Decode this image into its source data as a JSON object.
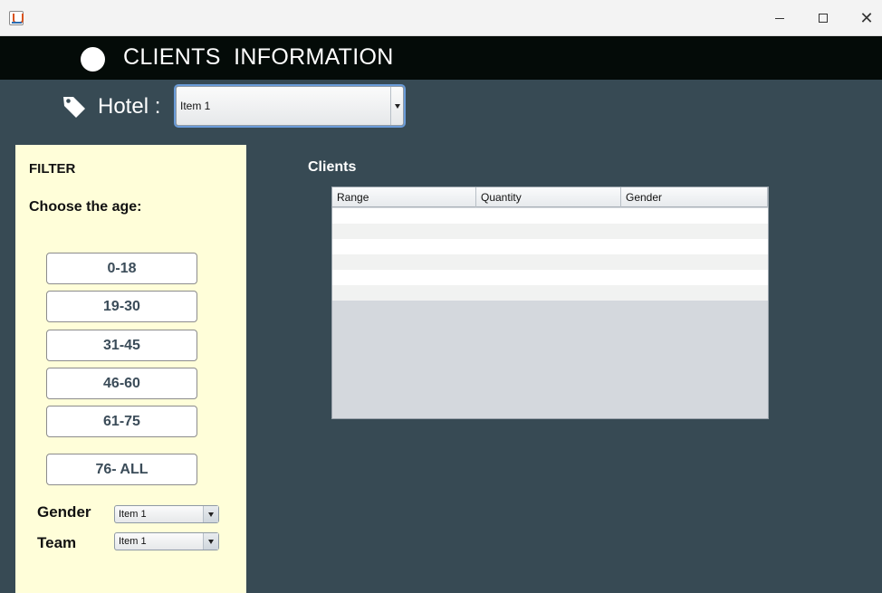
{
  "window": {
    "minimize_icon": "minimize-icon",
    "maximize_icon": "maximize-icon",
    "close_glyph": "✕"
  },
  "header": {
    "title": "CLIENTS  INFORMATION"
  },
  "hotel": {
    "label": "Hotel :",
    "selected": "Item 1"
  },
  "filter": {
    "title": "FILTER",
    "age_label": "Choose the age:",
    "age_ranges": [
      "0-18",
      "19-30",
      "31-45",
      "46-60",
      "61-75",
      "76- ALL"
    ],
    "gender_label": "Gender",
    "gender_selected": "Item 1",
    "team_label": "Team",
    "team_selected": "Item 1"
  },
  "clients": {
    "title": "Clients",
    "columns": [
      "Range",
      "Quantity",
      "Gender"
    ],
    "rows": [
      [
        "",
        "",
        ""
      ],
      [
        "",
        "",
        ""
      ],
      [
        "",
        "",
        ""
      ],
      [
        "",
        "",
        ""
      ],
      [
        "",
        "",
        ""
      ],
      [
        "",
        "",
        ""
      ]
    ]
  },
  "colors": {
    "header_bg": "#040b08",
    "main_bg": "#374a54",
    "filter_bg": "#fffed9",
    "button_text": "#3b4c59"
  }
}
